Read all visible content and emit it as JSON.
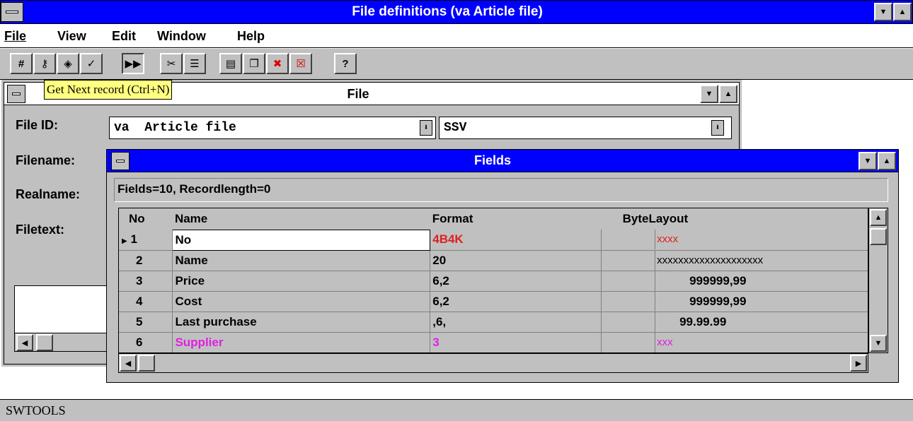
{
  "app": {
    "title": "File definitions (va Article file)",
    "status": "SWTOOLS"
  },
  "menu": [
    "File",
    "View",
    "Edit",
    "Window",
    "Help"
  ],
  "toolbar": {
    "icons": [
      "hash-icon",
      "key-icon",
      "disk-icon",
      "check-icon",
      "next-record-icon",
      "cut-icon",
      "list-icon",
      "window-icon",
      "cascade-icon",
      "delete-window-icon",
      "close-window-icon",
      "help-icon"
    ],
    "tooltip": "Get Next record (Ctrl+N)"
  },
  "file_window": {
    "title": "File",
    "labels": {
      "file_id": "File ID:",
      "filename": "Filename:",
      "realname": "Realname:",
      "filetext": "Filetext:"
    },
    "file_id_value": "va  Article file",
    "type_value": "SSV"
  },
  "fields_window": {
    "title": "Fields",
    "summary": "Fields=10, Recordlength=0",
    "columns": [
      "No",
      "Name",
      "Format",
      "ByteLayout"
    ],
    "rows": [
      {
        "no": "1",
        "name": "No",
        "format": "4B4K",
        "layout": "xxxx"
      },
      {
        "no": "2",
        "name": "Name",
        "format": "20",
        "layout": "xxxxxxxxxxxxxxxxxxxx"
      },
      {
        "no": "3",
        "name": "Price",
        "format": "6,2",
        "layout": "999999,99"
      },
      {
        "no": "4",
        "name": "Cost",
        "format": "6,2",
        "layout": "999999,99"
      },
      {
        "no": "5",
        "name": "Last purchase",
        "format": ",6,",
        "layout": "99.99.99"
      },
      {
        "no": "6",
        "name": "Supplier",
        "format": "3",
        "layout": "xxx"
      }
    ]
  },
  "colors": {
    "title_active": "#0000ff",
    "red_text": "#e02020",
    "magenta_text": "#e020e0",
    "tooltip_bg": "#ffff80"
  }
}
